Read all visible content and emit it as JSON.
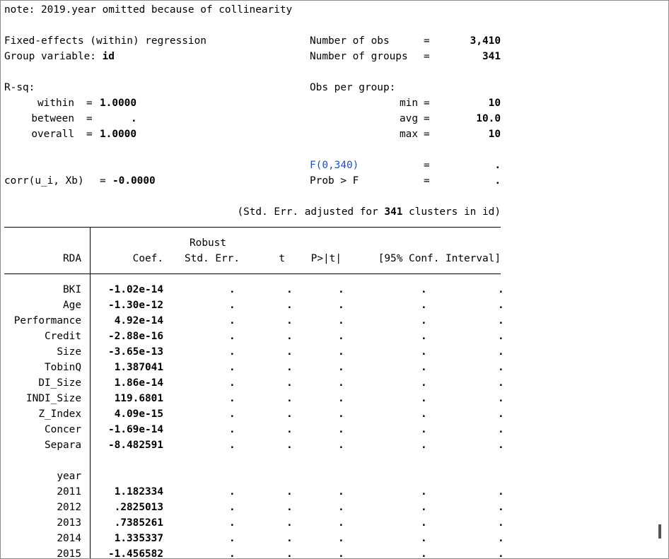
{
  "note": "note: 2019.year omitted because of collinearity",
  "header": {
    "model": "Fixed-effects (within) regression",
    "group_label": "Group variable: ",
    "group_var": "id",
    "nobs_label": "Number of obs",
    "nobs": "3,410",
    "ngroups_label": "Number of groups",
    "ngroups": "341",
    "eq": "=",
    "rsq_label": "R-sq:",
    "within_label": "within",
    "within": "1.0000",
    "between_label": "between",
    "between": ".",
    "overall_label": "overall",
    "overall": "1.0000",
    "obs_per_group": "Obs per group:",
    "min_label": "min",
    "min": "10",
    "avg_label": "avg",
    "avg": "10.0",
    "max_label": "max",
    "max": "10",
    "f_label": "F(0,340)",
    "f_value": ".",
    "corr_label": "corr(u_i, Xb)",
    "corr_value": "-0.0000",
    "prob_label": "Prob > F",
    "prob_value": ".",
    "clusters_pre": "(Std. Err. adjusted for ",
    "clusters_n": "341",
    "clusters_post": " clusters in id)"
  },
  "table": {
    "depvar": "RDA",
    "robust": "Robust",
    "coef": "Coef.",
    "stderr": "Std. Err.",
    "t": "t",
    "p": "P>|t|",
    "ci": "[95% Conf. Interval]",
    "rows": [
      {
        "name": "BKI",
        "coef": "-1.02e-14"
      },
      {
        "name": "Age",
        "coef": "-1.30e-12"
      },
      {
        "name": "Performance",
        "coef": "4.92e-14"
      },
      {
        "name": "Credit",
        "coef": "-2.88e-16"
      },
      {
        "name": "Size",
        "coef": "-3.65e-13"
      },
      {
        "name": "TobinQ",
        "coef": "1.387041"
      },
      {
        "name": "DI_Size",
        "coef": "1.86e-14"
      },
      {
        "name": "INDI_Size",
        "coef": "119.6801"
      },
      {
        "name": "Z_Index",
        "coef": "4.09e-15"
      },
      {
        "name": "Concer",
        "coef": "-1.69e-14"
      },
      {
        "name": "Separa",
        "coef": "-8.482591"
      }
    ],
    "year_label": "year",
    "year_rows": [
      {
        "name": "2011",
        "coef": "1.182334"
      },
      {
        "name": "2012",
        "coef": ".2825013"
      },
      {
        "name": "2013",
        "coef": ".7385261"
      },
      {
        "name": "2014",
        "coef": "1.335337"
      },
      {
        "name": "2015",
        "coef": "-1.456582"
      }
    ],
    "missing": "."
  }
}
